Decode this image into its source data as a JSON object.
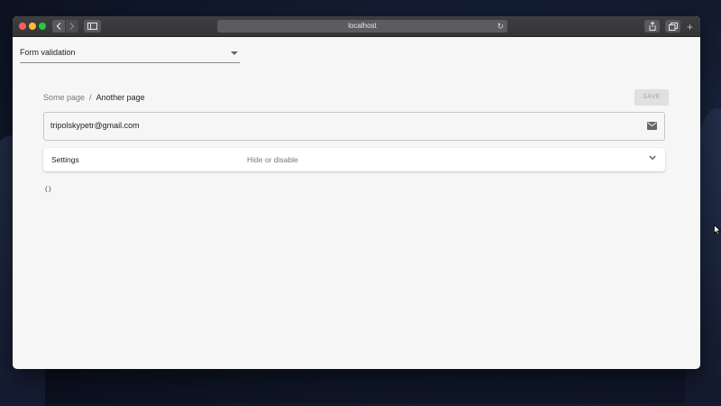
{
  "browser": {
    "url": "localhost",
    "reload_glyph": "↻",
    "newtab_glyph": "+"
  },
  "form": {
    "dropdown_value": "Form validation",
    "breadcrumb": {
      "items": [
        "Some page",
        "Another page"
      ],
      "separator": "/"
    },
    "save_label": "SAVE",
    "email_value": "tripolskypetr@gmail.com",
    "settings": {
      "title": "Settings",
      "subtitle": "Hide or disable"
    },
    "output": "{}"
  },
  "colors": {
    "traffic_red": "#fe5f57",
    "traffic_yellow": "#febc2e",
    "traffic_green": "#28c840",
    "save_disabled_bg": "#e0e0e0"
  },
  "icons": [
    "back-icon",
    "forward-icon",
    "sidebar-icon",
    "reload-icon",
    "share-icon",
    "tabs-icon",
    "mail-icon",
    "chevron-down-icon",
    "cursor-icon"
  ]
}
